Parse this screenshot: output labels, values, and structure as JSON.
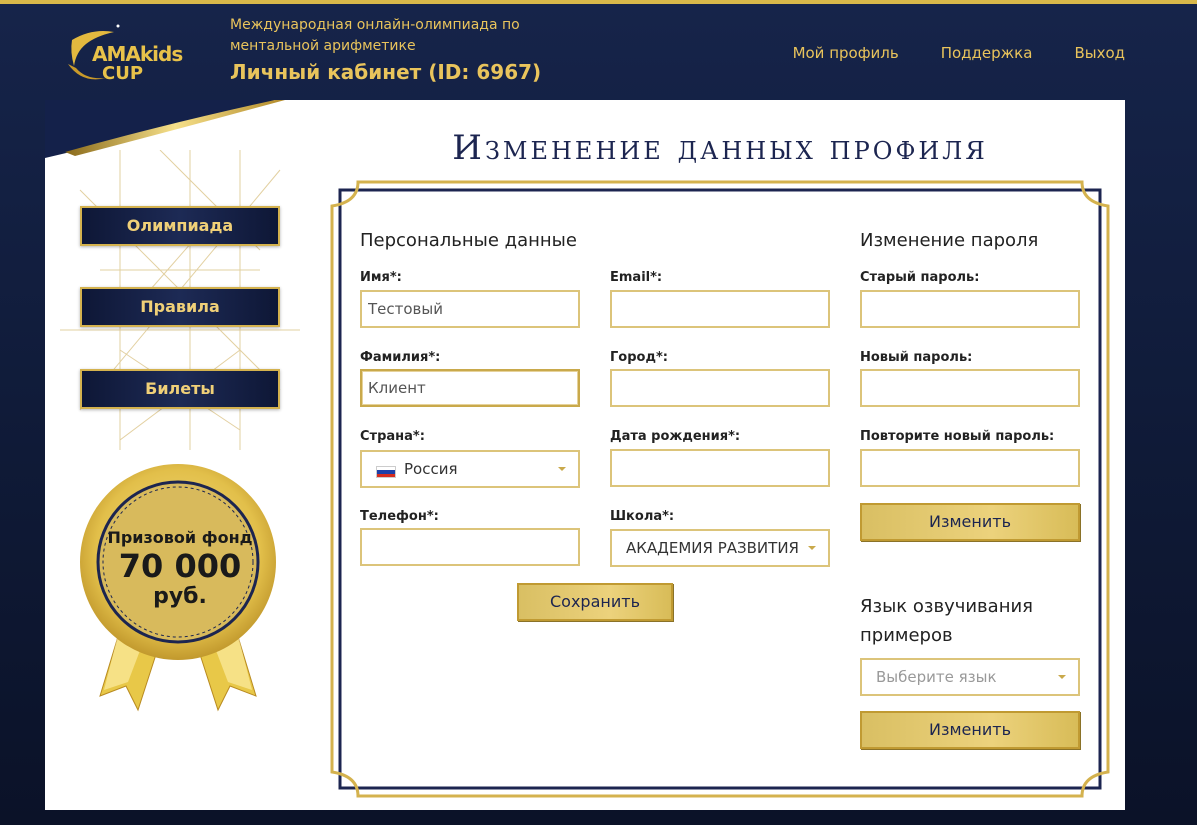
{
  "header": {
    "logo_text": "AMAkids",
    "logo_sub": "CUP",
    "subtitle": "Международная онлайн-олимпиада по ментальной арифметике",
    "title": "Личный кабинет (ID: 6967)",
    "nav": [
      "Мой профиль",
      "Поддержка",
      "Выход"
    ]
  },
  "sidebar": {
    "buttons": [
      "Олимпиада",
      "Правила",
      "Билеты"
    ],
    "prize": {
      "line1": "Призовой фонд",
      "amount": "70 000",
      "currency": "руб."
    }
  },
  "page_title": "Изменение данных профиля",
  "personal": {
    "heading": "Персональные данные",
    "first_name": {
      "label": "Имя*:",
      "value": "Тестовый"
    },
    "email": {
      "label": "Email*:",
      "value": ""
    },
    "last_name": {
      "label": "Фамилия*:",
      "value": "Клиент"
    },
    "city": {
      "label": "Город*:",
      "value": ""
    },
    "country": {
      "label": "Страна*:",
      "value": "Россия"
    },
    "birthdate": {
      "label": "Дата рождения*:",
      "value": ""
    },
    "phone": {
      "label": "Телефон*:",
      "value": ""
    },
    "school": {
      "label": "Школа*:",
      "value": "АКАДЕМИЯ РАЗВИТИЯ"
    },
    "save_label": "Сохранить"
  },
  "password": {
    "heading": "Изменение пароля",
    "old_label": "Старый пароль:",
    "new_label": "Новый пароль:",
    "repeat_label": "Повторите новый пароль:",
    "submit_label": "Изменить"
  },
  "language": {
    "heading": "Язык озвучивания примеров",
    "placeholder": "Выберите язык",
    "submit_label": "Изменить"
  },
  "colors": {
    "gold": "#d4b24e",
    "navy": "#16244a",
    "title": "#1c2550"
  }
}
